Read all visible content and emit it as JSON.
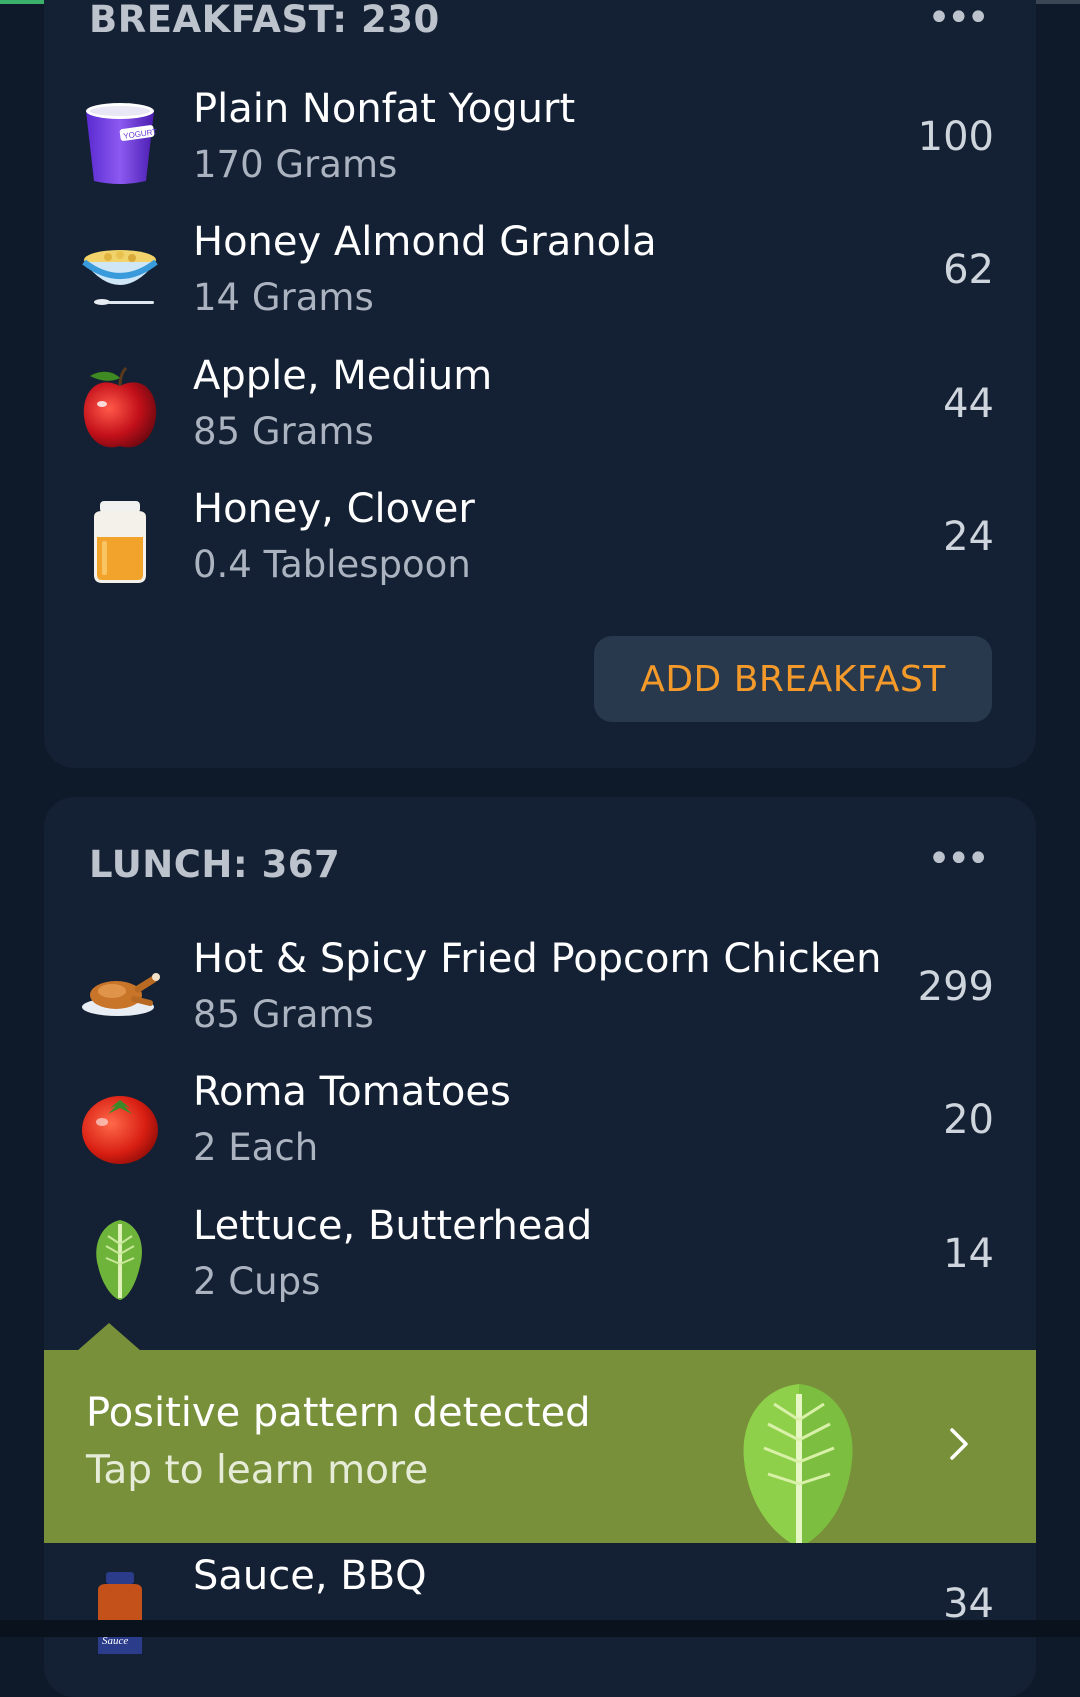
{
  "status_bar": {
    "progress_fraction": 0.67,
    "progress_color": "#3ab06a"
  },
  "breakfast": {
    "title": "BREAKFAST: 230",
    "more_label": "•••",
    "add_label": "ADD BREAKFAST",
    "items": [
      {
        "name": "Plain Nonfat Yogurt",
        "portion": "170 Grams",
        "calories": "100",
        "icon": "yogurt-icon",
        "icon_text": "YOGURT"
      },
      {
        "name": "Honey Almond Granola",
        "portion": "14 Grams",
        "calories": "62",
        "icon": "granola-bowl-icon"
      },
      {
        "name": "Apple, Medium",
        "portion": "85 Grams",
        "calories": "44",
        "icon": "apple-icon"
      },
      {
        "name": "Honey, Clover",
        "portion": "0.4 Tablespoon",
        "calories": "24",
        "icon": "honey-jar-icon"
      }
    ]
  },
  "lunch": {
    "title": "LUNCH: 367",
    "more_label": "•••",
    "items": [
      {
        "name": "Hot & Spicy Fried Popcorn Chicken",
        "portion": "85 Grams",
        "calories": "299",
        "icon": "chicken-icon"
      },
      {
        "name": "Roma Tomatoes",
        "portion": "2 Each",
        "calories": "20",
        "icon": "tomato-icon"
      },
      {
        "name": "Lettuce, Butterhead",
        "portion": "2 Cups",
        "calories": "14",
        "icon": "lettuce-icon"
      },
      {
        "name": "Sauce, BBQ",
        "portion": "",
        "calories": "34",
        "icon": "bbq-sauce-icon",
        "icon_text": "Sauce"
      }
    ]
  },
  "insight": {
    "title": "Positive pattern detected",
    "subtitle": "Tap to learn more",
    "background": "#78903a",
    "icon": "lettuce-icon"
  },
  "colors": {
    "background": "#0e1a29",
    "card": "#142033",
    "accent": "#f39a2b",
    "button": "#29394d"
  }
}
